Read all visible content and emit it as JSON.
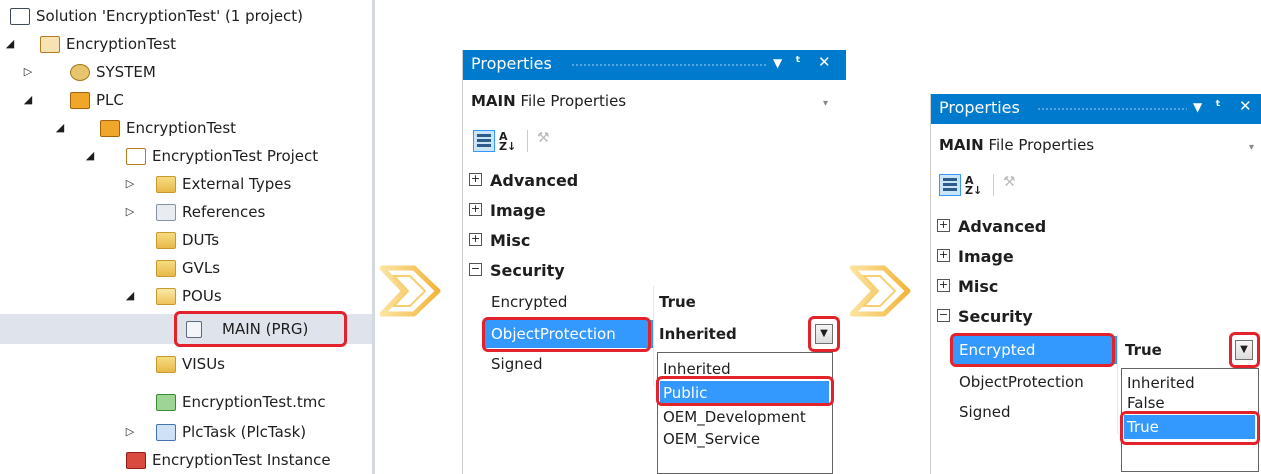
{
  "tree": {
    "items": [
      {
        "label": "Solution 'EncryptionTest' (1 project)",
        "icon": "solution-icon"
      },
      {
        "label": "EncryptionTest",
        "icon": "project-icon"
      },
      {
        "label": "SYSTEM",
        "icon": "system-icon"
      },
      {
        "label": "PLC",
        "icon": "plc-icon"
      },
      {
        "label": "EncryptionTest",
        "icon": "plc-project-icon"
      },
      {
        "label": "EncryptionTest Project",
        "icon": "plc-project-file-icon"
      },
      {
        "label": "External Types",
        "icon": "folder-icon"
      },
      {
        "label": "References",
        "icon": "references-icon"
      },
      {
        "label": "DUTs",
        "icon": "folder-icon"
      },
      {
        "label": "GVLs",
        "icon": "folder-icon"
      },
      {
        "label": "POUs",
        "icon": "folder-open-icon"
      },
      {
        "label": "MAIN (PRG)",
        "icon": "program-icon"
      },
      {
        "label": "VISUs",
        "icon": "folder-icon"
      },
      {
        "label": "EncryptionTest.tmc",
        "icon": "tmc-icon"
      },
      {
        "label": "PlcTask (PlcTask)",
        "icon": "task-icon"
      },
      {
        "label": "EncryptionTest Instance",
        "icon": "instance-icon"
      }
    ],
    "selected": "MAIN (PRG)"
  },
  "panel1": {
    "title": "Properties",
    "header_bold": "MAIN",
    "header_rest": "File Properties",
    "categories": [
      "Advanced",
      "Image",
      "Misc",
      "Security"
    ],
    "props": [
      {
        "name": "Encrypted",
        "value": "True"
      },
      {
        "name": "ObjectProtection",
        "value": "Inherited"
      },
      {
        "name": "Signed",
        "value": ""
      }
    ],
    "dropdown": [
      "Inherited",
      "Public",
      "OEM_Development",
      "OEM_Service"
    ],
    "dropdown_selected": "Public"
  },
  "panel2": {
    "title": "Properties",
    "header_bold": "MAIN",
    "header_rest": "File Properties",
    "categories": [
      "Advanced",
      "Image",
      "Misc",
      "Security"
    ],
    "props": [
      {
        "name": "Encrypted",
        "value": "True"
      },
      {
        "name": "ObjectProtection",
        "value": ""
      },
      {
        "name": "Signed",
        "value": ""
      }
    ],
    "dropdown": [
      "Inherited",
      "False",
      "True"
    ],
    "dropdown_selected": "True"
  },
  "glyphs": {
    "pin": "ᵖ",
    "close": "✕",
    "menu": "▼",
    "expand_collapsed": "▷",
    "expand_open": "◢",
    "plus": "+",
    "minus": "−",
    "caret": "▾",
    "dd": "▼",
    "wrench": "🔧"
  },
  "colors": {
    "title_bar": "#007acc",
    "selection": "#3399ff",
    "highlight_box": "#e2232c",
    "chevron": "#f2b53a"
  }
}
